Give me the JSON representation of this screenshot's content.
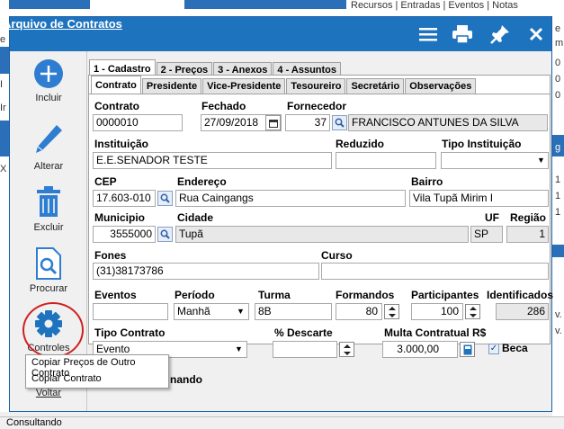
{
  "window": {
    "title": "Arquivo de Contratos"
  },
  "titlebar_icons": [
    "menu-icon",
    "print-icon",
    "pin-icon",
    "close-icon"
  ],
  "background": {
    "top_tabs": "Recursos | Entradas | Eventos | Notas",
    "right_chars": [
      "e",
      "m",
      "0",
      "0",
      "0",
      "g",
      "1",
      "1",
      "1",
      "v.",
      "v."
    ],
    "left_chars": [
      "e",
      "I",
      "Ir",
      "X"
    ]
  },
  "sidebar": {
    "items": [
      {
        "label": "Incluir",
        "icon": "plus-icon"
      },
      {
        "label": "Alterar",
        "icon": "pencil-icon"
      },
      {
        "label": "Excluir",
        "icon": "trash-icon"
      },
      {
        "label": "Procurar",
        "icon": "search-document-icon"
      },
      {
        "label": "Controles",
        "icon": "gear-icon"
      },
      {
        "label": "Voltar",
        "icon": "back-icon"
      }
    ]
  },
  "main_tabs": [
    "1 - Cadastro",
    "2 - Preços",
    "3 - Anexos",
    "4 - Assuntos"
  ],
  "sub_tabs": [
    "Contrato",
    "Presidente",
    "Vice-Presidente",
    "Tesoureiro",
    "Secretário",
    "Observações"
  ],
  "form": {
    "contrato": {
      "label": "Contrato",
      "value": "0000010"
    },
    "fechado": {
      "label": "Fechado",
      "value": "27/09/2018"
    },
    "fornecedor": {
      "label": "Fornecedor",
      "code": "37",
      "name": "FRANCISCO ANTUNES DA SILVA"
    },
    "instituicao": {
      "label": "Instituição",
      "value": "E.E.SENADOR TESTE"
    },
    "reduzido": {
      "label": "Reduzido",
      "value": ""
    },
    "tipo_instituicao": {
      "label": "Tipo Instituição",
      "value": ""
    },
    "cep": {
      "label": "CEP",
      "value": "17.603-010"
    },
    "endereco": {
      "label": "Endereço",
      "value": "Rua Caingangs"
    },
    "bairro": {
      "label": "Bairro",
      "value": "Vila Tupã Mirim I"
    },
    "municipio": {
      "label": "Municipio",
      "value": "3555000"
    },
    "cidade": {
      "label": "Cidade",
      "value": "Tupã"
    },
    "uf": {
      "label": "UF",
      "value": "SP"
    },
    "regiao": {
      "label": "Região",
      "value": "1"
    },
    "fones": {
      "label": "Fones",
      "value": "(31)38173786"
    },
    "curso": {
      "label": "Curso",
      "value": ""
    },
    "eventos": {
      "label": "Eventos",
      "value": ""
    },
    "periodo": {
      "label": "Período",
      "value": "Manhã"
    },
    "turma": {
      "label": "Turma",
      "value": "8B"
    },
    "formandos": {
      "label": "Formandos",
      "value": "80"
    },
    "participantes": {
      "label": "Participantes",
      "value": "100"
    },
    "identificados": {
      "label": "Identificados",
      "value": "286"
    },
    "tipo_contrato": {
      "label": "Tipo Contrato",
      "value": "Evento"
    },
    "descarte": {
      "label": "% Descarte",
      "value": ""
    },
    "multa": {
      "label": "Multa Contratual R$",
      "value": "3.000,00"
    },
    "beca": {
      "label": "Beca",
      "checked": true
    },
    "situacao_partial": "nando"
  },
  "context_menu": {
    "items": [
      "Copiar Preços de Outro Contrato",
      "Copiar Contrato"
    ]
  },
  "status": {
    "text": "Consultando"
  },
  "colors": {
    "titlebar": "#1e73be",
    "accent": "#1a5fa8",
    "highlight_circle": "#d02020"
  }
}
